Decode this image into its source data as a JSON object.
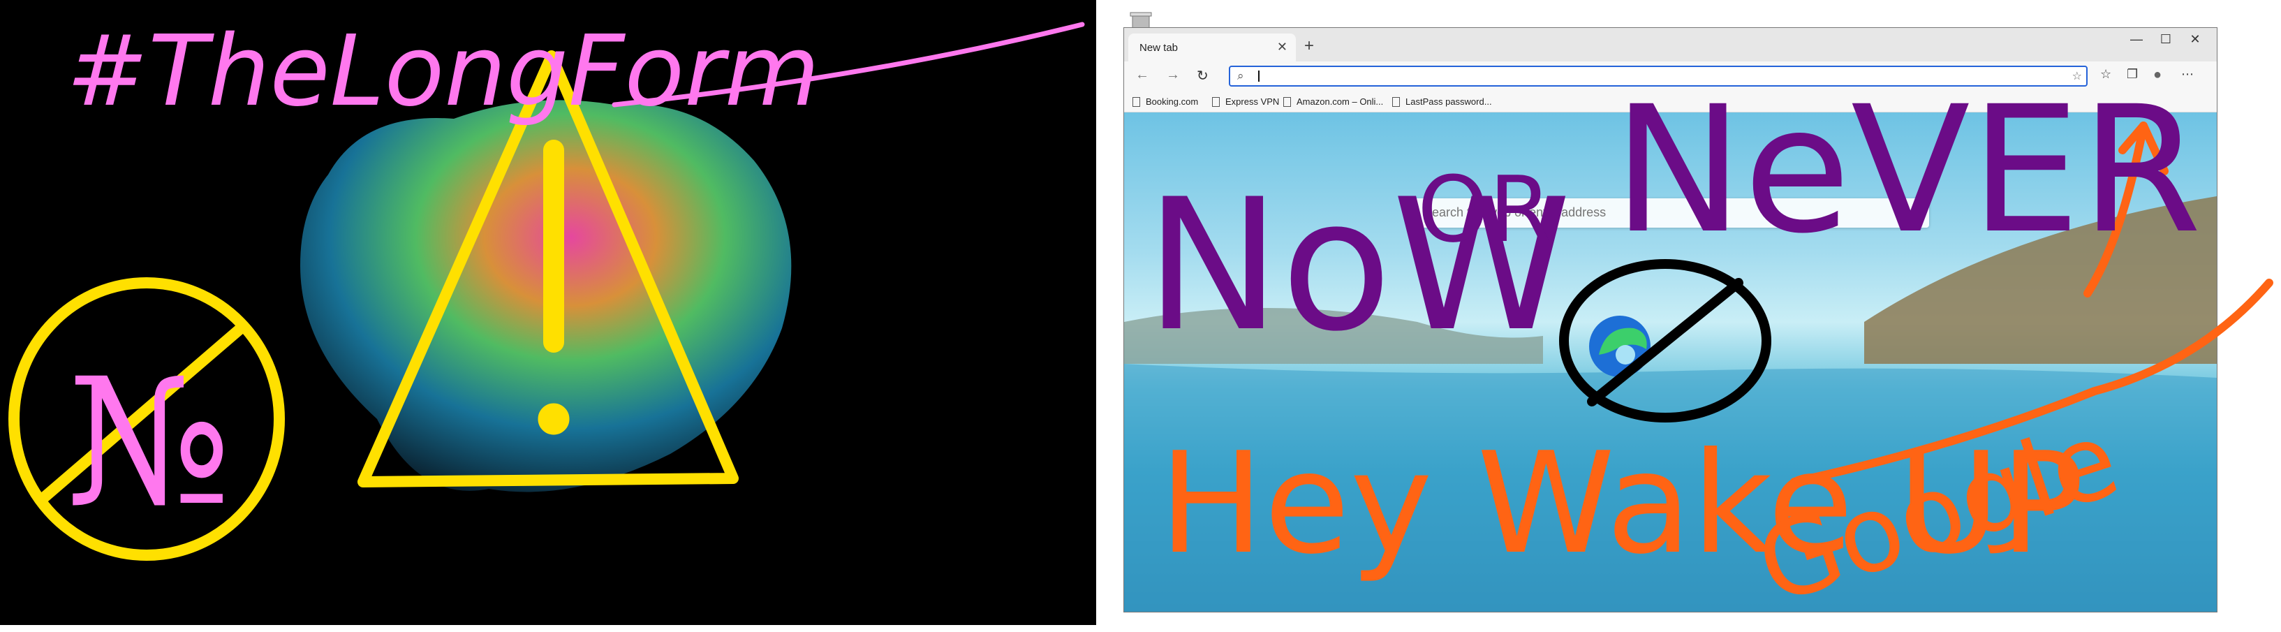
{
  "browser": {
    "tab_title": "New tab",
    "tab_close_icon": "close-icon",
    "new_tab_symbol": "+",
    "window_controls": {
      "minimize": "—",
      "maximize": "☐",
      "close": "✕"
    },
    "nav": {
      "back": "←",
      "forward": "→",
      "refresh": "↻"
    },
    "address_value": "",
    "favorites": [
      "Booking.com",
      "Express VPN",
      "Amazon.com – Onli...",
      "LastPass password..."
    ],
    "page_search_placeholder": "Search the web or enter address"
  },
  "annotations": {
    "hashtag": "#TheLongForm",
    "now_or_never_1": "NoW",
    "now_or_never_2": "OR",
    "now_or_never_3": "NeVER",
    "wake": "Hey Wake UP",
    "google": "Google",
    "number_sign": "№"
  },
  "colors": {
    "pink": "#ff78ee",
    "yellow": "#ffe000",
    "purple": "#6b0c87",
    "orange": "#ff6414",
    "black": "#000000",
    "edge_blue": "#1d6fd6",
    "edge_green": "#3ccf6b"
  }
}
